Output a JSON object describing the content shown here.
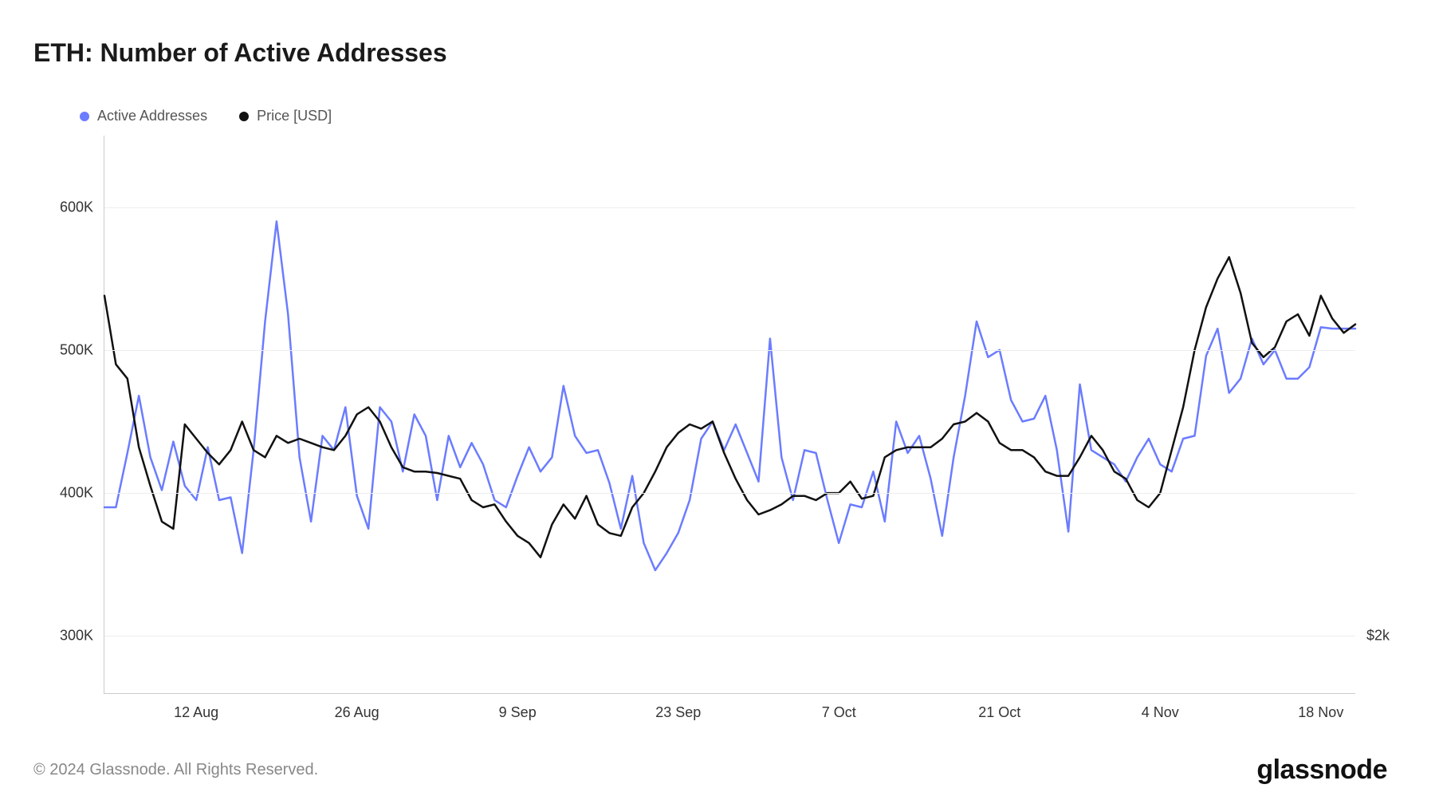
{
  "title": "ETH: Number of Active Addresses",
  "legend": {
    "series1": {
      "label": "Active Addresses",
      "color": "#6b7cff"
    },
    "series2": {
      "label": "Price [USD]",
      "color": "#111111"
    }
  },
  "footer": "© 2024 Glassnode. All Rights Reserved.",
  "brand": "glassnode",
  "chart_data": {
    "type": "line",
    "y_left": {
      "label": "",
      "min": 260000,
      "max": 650000,
      "ticks": [
        300000,
        400000,
        500000,
        600000
      ],
      "tick_labels": [
        "300K",
        "400K",
        "500K",
        "600K"
      ]
    },
    "y_right": {
      "label": "",
      "ticks": [
        2000
      ],
      "tick_labels": [
        "$2k"
      ]
    },
    "x_tick_labels": [
      "12 Aug",
      "26 Aug",
      "9 Sep",
      "23 Sep",
      "7 Oct",
      "21 Oct",
      "4 Nov",
      "18 Nov"
    ],
    "x_tick_indices": [
      8,
      22,
      36,
      50,
      64,
      78,
      92,
      106
    ],
    "n_points": 110,
    "series": [
      {
        "name": "Active Addresses",
        "color": "#6b7cff",
        "axis": "left",
        "values": [
          390000,
          390000,
          428000,
          468000,
          425000,
          402000,
          436000,
          405000,
          395000,
          432000,
          395000,
          397000,
          358000,
          430000,
          520000,
          590000,
          525000,
          425000,
          380000,
          440000,
          430000,
          460000,
          398000,
          375000,
          460000,
          450000,
          415000,
          455000,
          440000,
          395000,
          440000,
          418000,
          435000,
          420000,
          395000,
          390000,
          412000,
          432000,
          415000,
          425000,
          475000,
          440000,
          428000,
          430000,
          407000,
          375000,
          412000,
          365000,
          346000,
          358000,
          372000,
          395000,
          438000,
          450000,
          430000,
          448000,
          428000,
          408000,
          508000,
          425000,
          395000,
          430000,
          428000,
          395000,
          365000,
          392000,
          390000,
          415000,
          380000,
          450000,
          428000,
          440000,
          410000,
          370000,
          425000,
          468000,
          520000,
          495000,
          500000,
          465000,
          450000,
          452000,
          468000,
          430000,
          373000,
          476000,
          430000,
          425000,
          420000,
          408000,
          425000,
          438000,
          420000,
          415000,
          438000,
          440000,
          496000,
          515000,
          470000,
          480000,
          508000,
          490000,
          500000,
          480000,
          480000,
          488000,
          516000,
          515000,
          515000,
          515000
        ]
      },
      {
        "name": "Price [USD]",
        "color": "#111111",
        "axis": "left_proxy",
        "values": [
          538000,
          490000,
          480000,
          432000,
          405000,
          380000,
          375000,
          448000,
          438000,
          428000,
          420000,
          430000,
          450000,
          430000,
          425000,
          440000,
          435000,
          438000,
          435000,
          432000,
          430000,
          440000,
          455000,
          460000,
          450000,
          432000,
          418000,
          415000,
          415000,
          414000,
          412000,
          410000,
          395000,
          390000,
          392000,
          380000,
          370000,
          365000,
          355000,
          378000,
          392000,
          382000,
          398000,
          378000,
          372000,
          370000,
          390000,
          400000,
          415000,
          432000,
          442000,
          448000,
          445000,
          450000,
          428000,
          410000,
          395000,
          385000,
          388000,
          392000,
          398000,
          398000,
          395000,
          400000,
          400000,
          408000,
          396000,
          398000,
          425000,
          430000,
          432000,
          432000,
          432000,
          438000,
          448000,
          450000,
          456000,
          450000,
          435000,
          430000,
          430000,
          425000,
          415000,
          412000,
          412000,
          425000,
          440000,
          430000,
          415000,
          410000,
          395000,
          390000,
          400000,
          430000,
          460000,
          500000,
          530000,
          550000,
          565000,
          540000,
          505000,
          495000,
          502000,
          520000,
          525000,
          510000,
          538000,
          522000,
          512000,
          518000
        ]
      }
    ]
  }
}
